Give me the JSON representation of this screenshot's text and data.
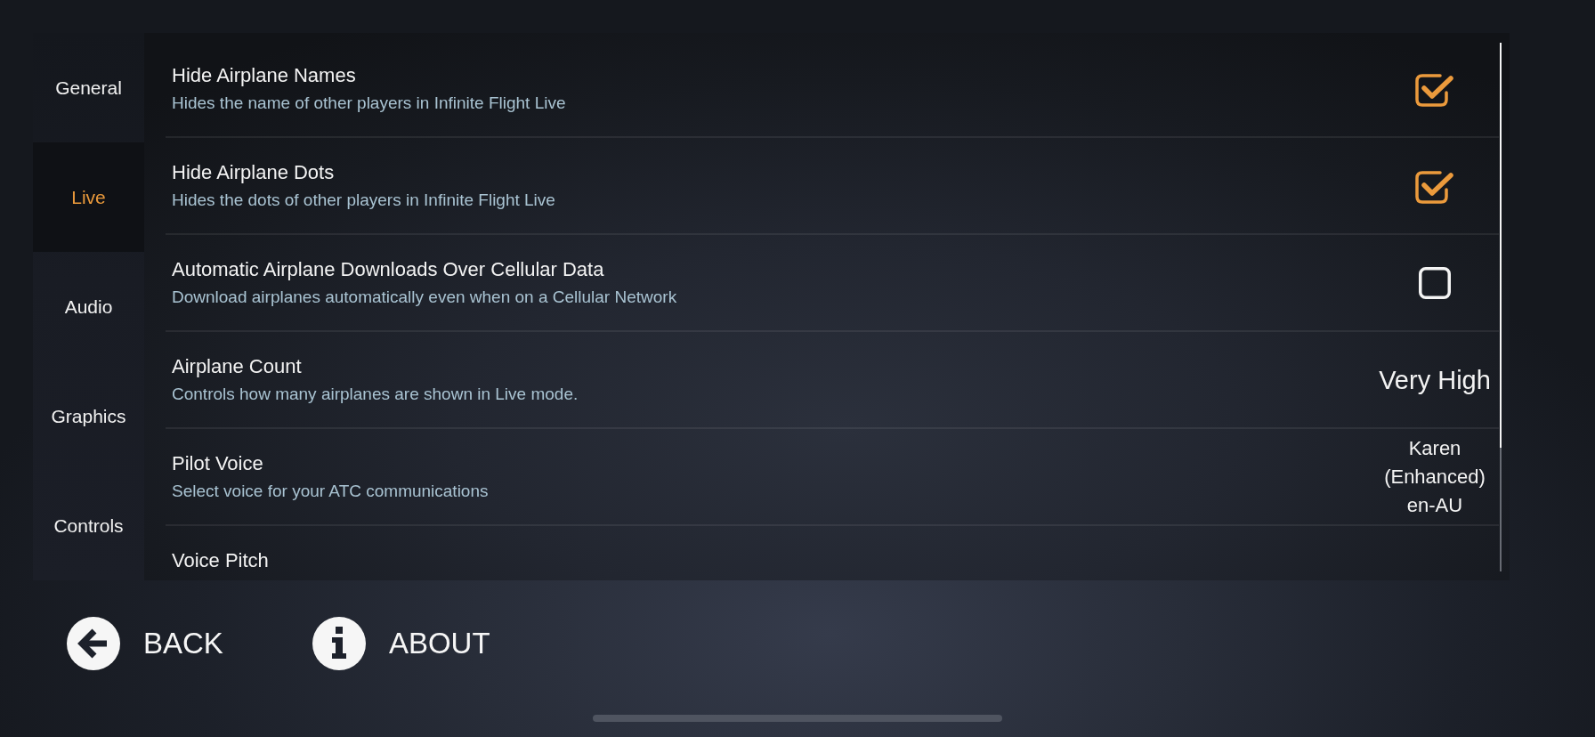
{
  "sidebar": {
    "items": [
      {
        "label": "General",
        "selected": false
      },
      {
        "label": "Live",
        "selected": true
      },
      {
        "label": "Audio",
        "selected": false
      },
      {
        "label": "Graphics",
        "selected": false
      },
      {
        "label": "Controls",
        "selected": false
      }
    ]
  },
  "settings": [
    {
      "kind": "checkbox",
      "title": "Hide Airplane Names",
      "description": "Hides the name of other players in Infinite Flight Live",
      "checked": true
    },
    {
      "kind": "checkbox",
      "title": "Hide Airplane Dots",
      "description": "Hides the dots of other players in Infinite Flight Live",
      "checked": true
    },
    {
      "kind": "checkbox",
      "title": "Automatic Airplane Downloads Over Cellular Data",
      "description": "Download airplanes automatically even when on a Cellular Network",
      "checked": false
    },
    {
      "kind": "choice",
      "title": "Airplane Count",
      "description": "Controls how many airplanes are shown in Live mode.",
      "value": "Very High"
    },
    {
      "kind": "voice",
      "title": "Pilot Voice",
      "description": "Select voice for your ATC communications",
      "value": "Karen (Enhanced) en-AU"
    },
    {
      "kind": "choice",
      "title": "Voice Pitch"
    }
  ],
  "footer": {
    "buttons": [
      {
        "kind": "back",
        "label": "BACK"
      },
      {
        "kind": "about",
        "label": "ABOUT"
      }
    ]
  }
}
